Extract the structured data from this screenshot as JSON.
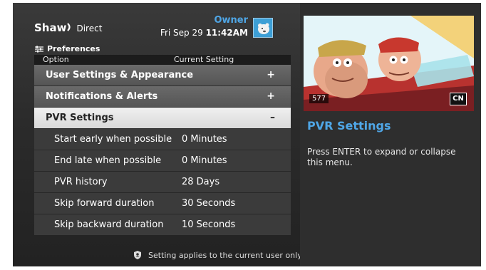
{
  "header": {
    "brand_main": "Shaw",
    "brand_sub": "Direct",
    "user_name": "Owner",
    "date": "Fri Sep 29",
    "time": "11:42AM"
  },
  "breadcrumb": {
    "label": "Preferences"
  },
  "columns": {
    "option": "Option",
    "current_setting": "Current Setting"
  },
  "menu": {
    "categories": [
      {
        "label": "User Settings & Appearance",
        "sign": "+"
      },
      {
        "label": "Notifications & Alerts",
        "sign": "+"
      },
      {
        "label": "PVR Settings",
        "sign": "–"
      }
    ],
    "settings": [
      {
        "label": "Start early when possible",
        "value": "0 Minutes"
      },
      {
        "label": "End late when possible",
        "value": "0 Minutes"
      },
      {
        "label": "PVR history",
        "value": "28 Days"
      },
      {
        "label": "Skip forward duration",
        "value": "30 Seconds"
      },
      {
        "label": "Skip backward duration",
        "value": "10 Seconds"
      }
    ]
  },
  "footer": {
    "note": "Setting applies to the current user only"
  },
  "preview": {
    "channel": "577",
    "network_logo": "CN"
  },
  "info": {
    "title": "PVR Settings",
    "description": "Press ENTER to expand or collapse this menu."
  },
  "colors": {
    "accent_blue": "#4fa6e6",
    "selected_row": "#e6e6e6",
    "category_row": "#5e5e5e"
  }
}
